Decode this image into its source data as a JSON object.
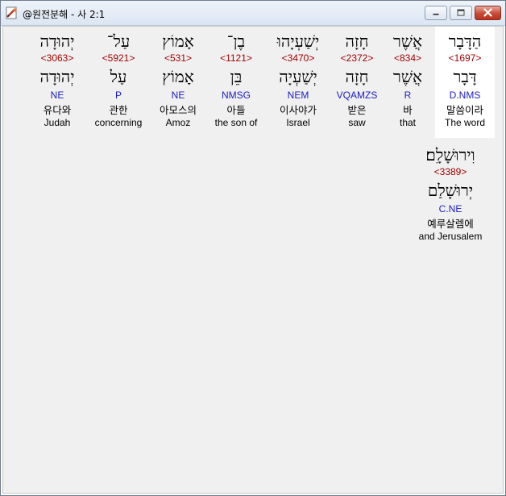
{
  "window": {
    "title": "@원전분해 - 사 2:1"
  },
  "words": [
    {
      "hebrew": "הַדָּבָר",
      "strong": "<1697>",
      "lemma": "דָּבָר",
      "parse": "D.NMS",
      "korean": "말씀이라",
      "english": "The word"
    },
    {
      "hebrew": "אֲשֶׁר",
      "strong": "<834>",
      "lemma": "אֲשֶׁר",
      "parse": "R",
      "korean": "바",
      "english": "that"
    },
    {
      "hebrew": "חָזָה",
      "strong": "<2372>",
      "lemma": "חָזָה",
      "parse": "VQAMZS",
      "korean": "받은",
      "english": "saw"
    },
    {
      "hebrew": "יְשַׁעְיָהוּ",
      "strong": "<3470>",
      "lemma": "יְשַׁעְיָה",
      "parse": "NEM",
      "korean": "이사야가",
      "english": "Israel"
    },
    {
      "hebrew": "בֶן־",
      "strong": "<1121>",
      "lemma": "בֵּן",
      "parse": "NMSG",
      "korean": "아들",
      "english": "the son of"
    },
    {
      "hebrew": "אָמוֹץ",
      "strong": "<531>",
      "lemma": "אָמוֹץ",
      "parse": "NE",
      "korean": "아모스의",
      "english": "Amoz"
    },
    {
      "hebrew": "עַל־",
      "strong": "<5921>",
      "lemma": "עַל",
      "parse": "P",
      "korean": "관한",
      "english": "concerning"
    },
    {
      "hebrew": "יְהוּדָה",
      "strong": "<3063>",
      "lemma": "יְהוּדָה",
      "parse": "NE",
      "korean": "유다와",
      "english": "Judah"
    },
    {
      "hebrew": "וִירוּשָׁלִָם׃",
      "strong": "<3389>",
      "lemma": "יְרוּשָׁלַם",
      "parse": "C.NE",
      "korean": "예루살렘에",
      "english": "and Jerusalem"
    }
  ]
}
